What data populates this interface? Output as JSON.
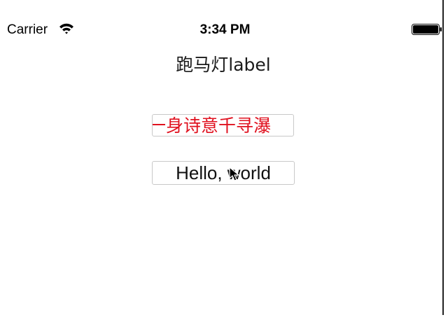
{
  "status_bar": {
    "carrier": "Carrier",
    "time": "3:34 PM",
    "wifi_icon": "wifi-icon",
    "battery_icon": "battery-full-icon"
  },
  "nav": {
    "title": "跑马灯label"
  },
  "marquee_label": {
    "text": "一身诗意千寻瀑",
    "color": "#e0111f"
  },
  "hello_label": {
    "text": "Hello, world"
  },
  "cursor_icon": "mouse-pointer-icon"
}
